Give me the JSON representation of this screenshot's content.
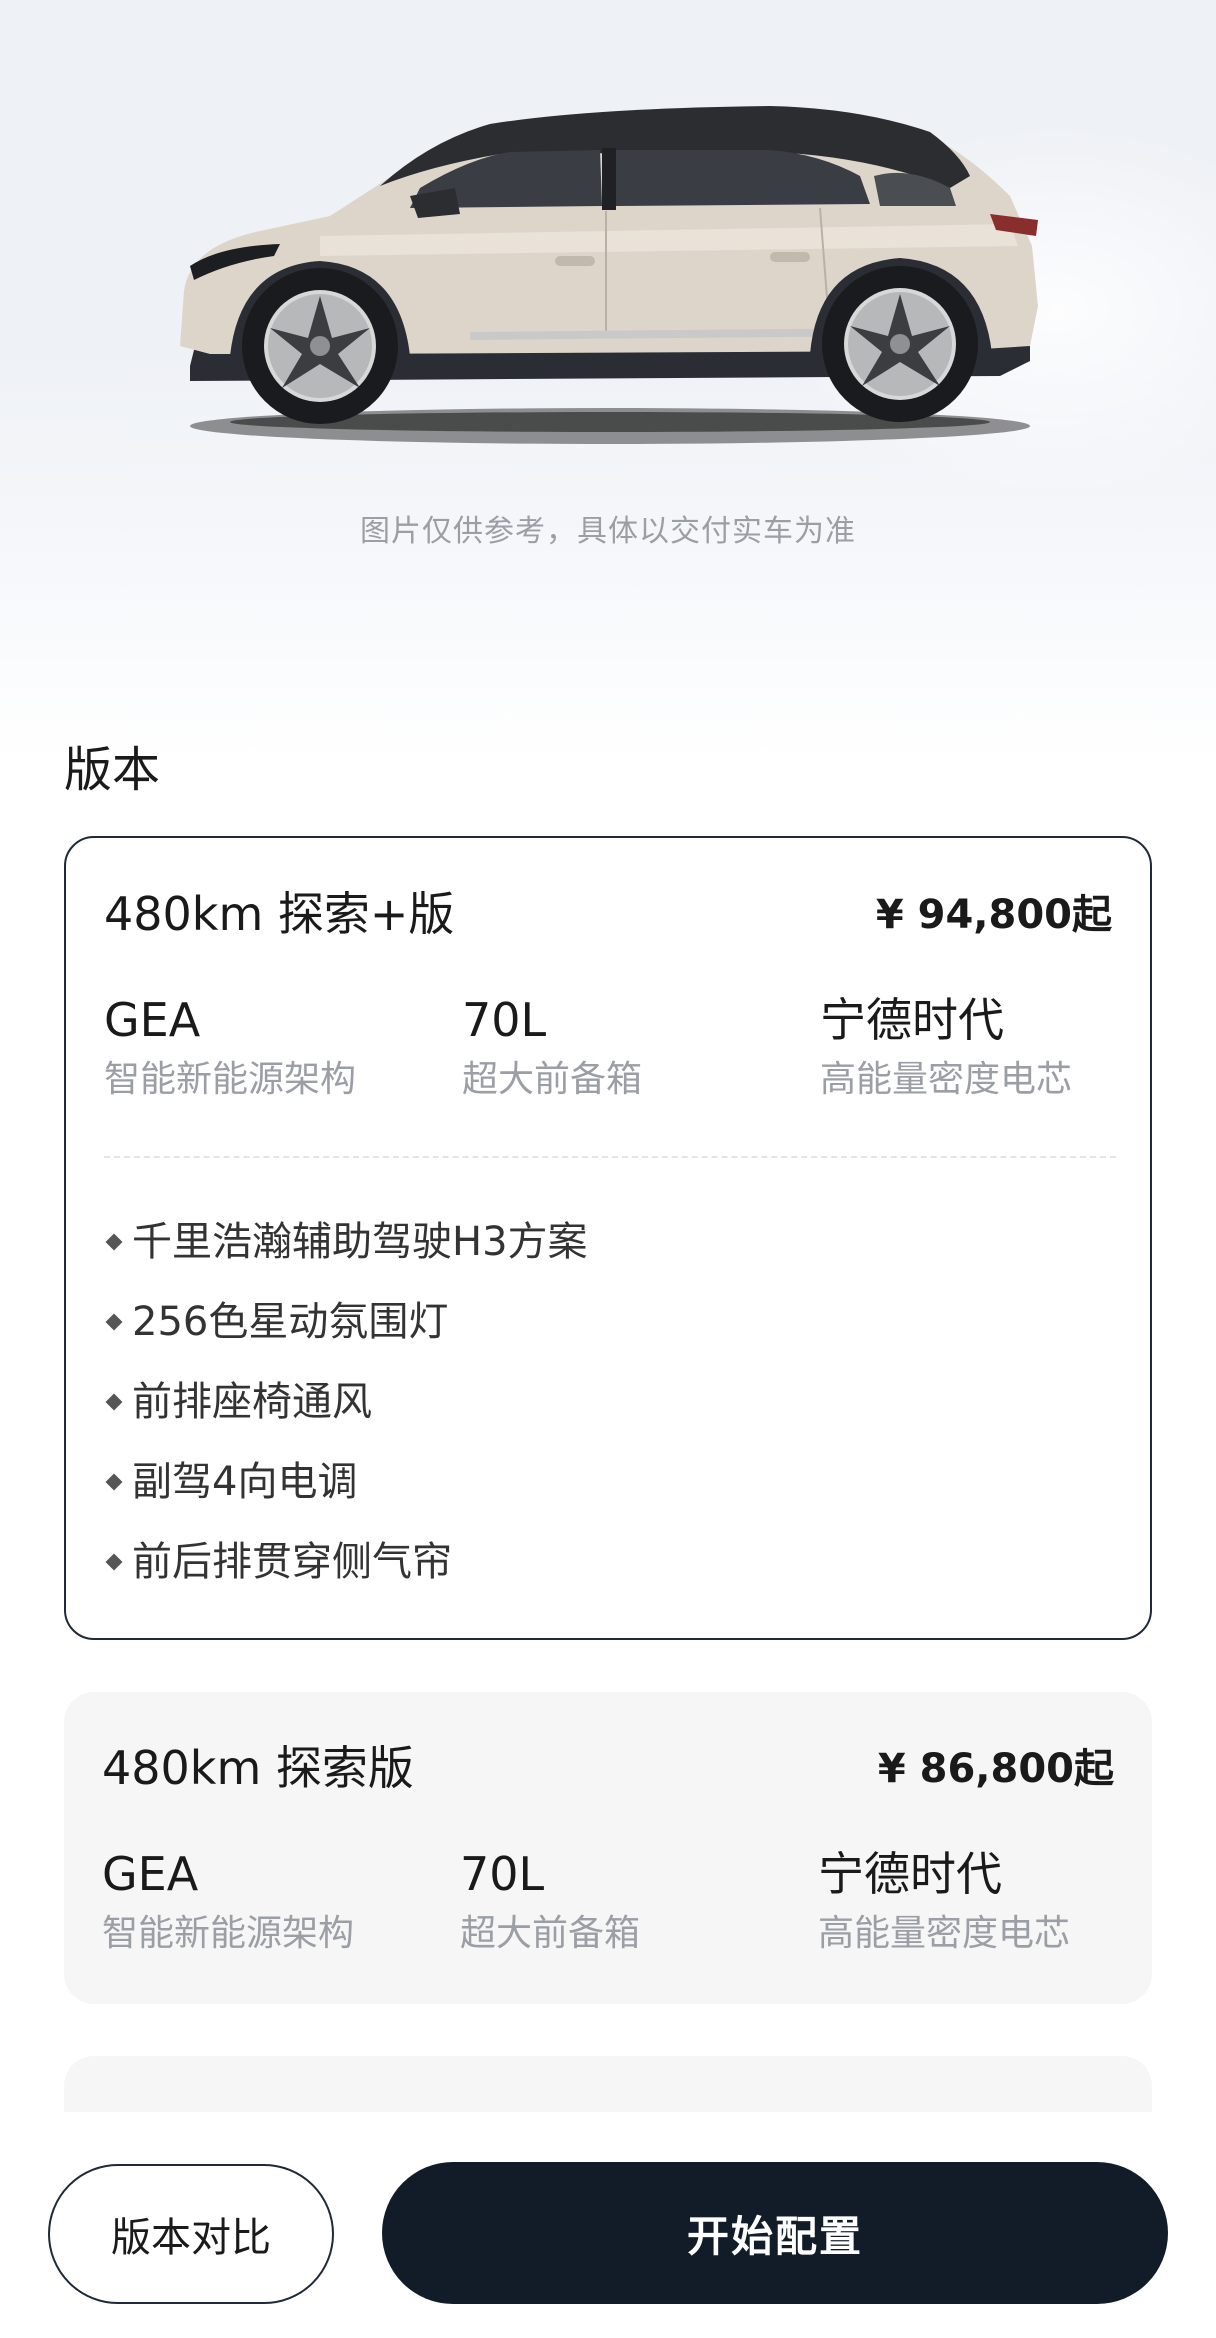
{
  "hero": {
    "disclaimer": "图片仅供参考，具体以交付实车为准"
  },
  "section": {
    "title": "版本"
  },
  "versions": [
    {
      "name": "480km 探索+版",
      "price": "¥ 94,800起",
      "selected": true,
      "specs": [
        {
          "value": "GEA",
          "label": "智能新能源架构"
        },
        {
          "value": "70L",
          "label": "超大前备箱"
        },
        {
          "value": "宁德时代",
          "label": "高能量密度电芯"
        }
      ],
      "features": [
        "千里浩瀚辅助驾驶H3方案",
        "256色星动氛围灯",
        "前排座椅通风",
        "副驾4向电调",
        "前后排贯穿侧气帘"
      ]
    },
    {
      "name": "480km 探索版",
      "price": "¥ 86,800起",
      "selected": false,
      "specs": [
        {
          "value": "GEA",
          "label": "智能新能源架构"
        },
        {
          "value": "70L",
          "label": "超大前备箱"
        },
        {
          "value": "宁德时代",
          "label": "高能量密度电芯"
        }
      ]
    }
  ],
  "bottom_bar": {
    "compare_label": "版本对比",
    "configure_label": "开始配置"
  },
  "colors": {
    "primary_dark": "#121c28",
    "card_border": "#1f2937",
    "muted_text": "#9b9ea4",
    "card_background": "#f6f6f7"
  }
}
